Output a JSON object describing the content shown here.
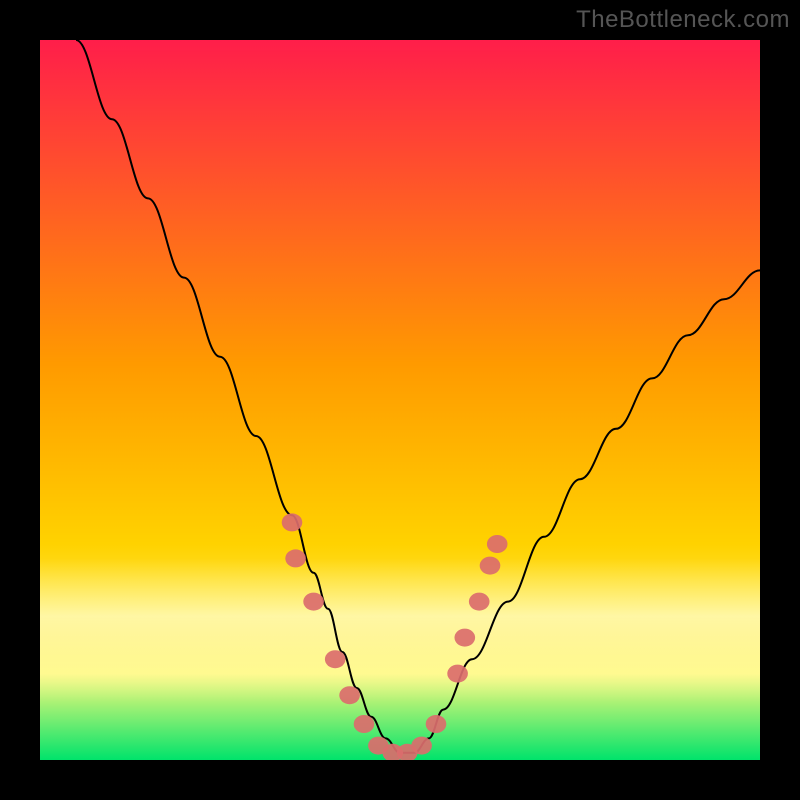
{
  "watermark": "TheBottleneck.com",
  "chart_data": {
    "type": "line",
    "title": "",
    "xlabel": "",
    "ylabel": "",
    "xlim": [
      0,
      100
    ],
    "ylim": [
      0,
      100
    ],
    "background_gradient": {
      "top_color": "#ff1e4a",
      "mid_color": "#ffd200",
      "bottom_color": "#00e36b"
    },
    "glow_band": {
      "y_start": 72,
      "y_end": 92,
      "color": "#ffffb0",
      "alpha": 0.55
    },
    "series": [
      {
        "name": "curve",
        "type": "line",
        "color": "#000000",
        "width": 2,
        "x": [
          5,
          10,
          15,
          20,
          25,
          30,
          35,
          38,
          40,
          42,
          44,
          46,
          48,
          50,
          52,
          54,
          56,
          60,
          65,
          70,
          75,
          80,
          85,
          90,
          95,
          100
        ],
        "y": [
          100,
          89,
          78,
          67,
          56,
          45,
          34,
          26,
          21,
          15,
          10,
          6,
          3,
          1,
          1,
          3,
          7,
          14,
          22,
          31,
          39,
          46,
          53,
          59,
          64,
          68
        ]
      },
      {
        "name": "markers",
        "type": "scatter",
        "color": "#db6c6c",
        "radius": 9,
        "x": [
          35,
          35.5,
          38,
          41,
          43,
          45,
          47,
          49,
          51,
          53,
          55,
          58,
          59,
          61,
          62.5,
          63.5
        ],
        "y": [
          33,
          28,
          22,
          14,
          9,
          5,
          2,
          1,
          1,
          2,
          5,
          12,
          17,
          22,
          27,
          30
        ]
      }
    ]
  }
}
